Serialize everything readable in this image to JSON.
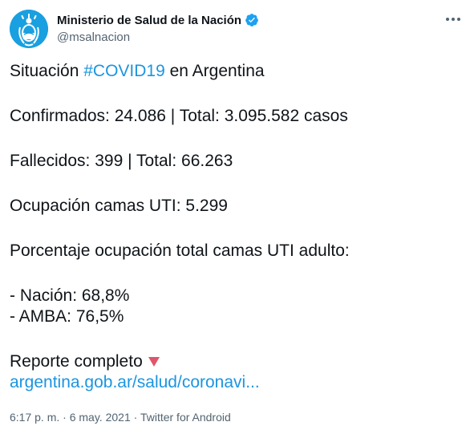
{
  "author": {
    "display_name": "Ministerio de Salud de la Nación",
    "handle": "@msalnacion",
    "avatar_icon": "argentina-coat-of-arms-icon",
    "verified_icon": "verified-badge-icon",
    "avatar_color": "#19a0e0",
    "verified_color": "#1da1f2"
  },
  "more_icon": "more-horizontal-icon",
  "tweet": {
    "line1_prefix": "Situación ",
    "line1_hashtag": "#COVID19",
    "line1_suffix": " en Argentina",
    "confirmados": "Confirmados: 24.086 | Total: 3.095.582 casos",
    "fallecidos": "Fallecidos: 399 | Total: 66.263",
    "ocupacion": "Ocupación camas UTI: 5.299",
    "porcentaje": "Porcentaje ocupación total camas UTI adulto:",
    "nacion": "- Nación: 68,8%",
    "amba": "- AMBA: 76,5%",
    "reporte": "Reporte completo",
    "reporte_icon": "red-down-triangle-icon",
    "link": "argentina.gob.ar/salud/coronavi...",
    "link_color": "#1b95e0"
  },
  "meta": {
    "time": "6:17 p. m.",
    "separator": " · ",
    "date": "6 may. 2021",
    "source": "Twitter for Android"
  }
}
